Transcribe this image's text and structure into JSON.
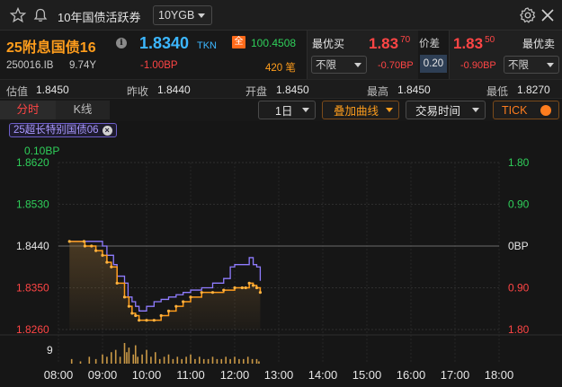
{
  "topbar": {
    "title": "10年国债活跃券",
    "selector_value": "10YGB"
  },
  "quote": {
    "name": "25附息国债16",
    "last_price": "1.8340",
    "price_source": "TKN",
    "all_badge": "全",
    "net_price": "100.4508",
    "code": "250016.IB",
    "tenor": "9.74Y",
    "change": "-1.00BP",
    "volume": "420 笔",
    "best_bid": {
      "label": "最优买",
      "price_main": "1.83",
      "price_sub": "70",
      "filter": "不限",
      "change": "-0.70BP"
    },
    "spread": {
      "label": "价差",
      "value": "0.20"
    },
    "best_ask": {
      "label": "最优卖",
      "price_main": "1.83",
      "price_sub": "50",
      "filter": "不限",
      "change": "-0.90BP"
    }
  },
  "stats": [
    {
      "label": "估值",
      "value": "1.8450"
    },
    {
      "label": "昨收",
      "value": "1.8440"
    },
    {
      "label": "开盘",
      "value": "1.8450"
    },
    {
      "label": "最高",
      "value": "1.8450"
    },
    {
      "label": "最低",
      "value": "1.8270"
    }
  ],
  "tabs": [
    {
      "label": "分时",
      "active": true
    },
    {
      "label": "K线",
      "active": false
    }
  ],
  "controls": {
    "period": "1日",
    "overlay": "叠加曲线",
    "trading_time": "交易时间",
    "tick": "TICK"
  },
  "overlay_chip": "25超长特别国债06",
  "chart_data": {
    "type": "line",
    "spread_label": "0.10BP",
    "y_left_ticks": [
      "1.8620",
      "1.8530",
      "1.8440",
      "1.8350",
      "1.8260"
    ],
    "y_right_ticks": [
      "1.80",
      "0.90",
      "0BP",
      "0.90",
      "1.80"
    ],
    "x_ticks": [
      "08:00",
      "09:00",
      "10:00",
      "11:00",
      "12:00",
      "13:00",
      "14:00",
      "15:00",
      "16:00",
      "17:00",
      "18:00"
    ],
    "volume_max_label": "9",
    "ylim": [
      1.826,
      1.862
    ],
    "prev_close": 1.844,
    "series": [
      {
        "name": "25附息国债16",
        "color": "#ff9d1c",
        "x": [
          8.25,
          8.58,
          8.6,
          8.75,
          8.85,
          9.0,
          9.1,
          9.2,
          9.33,
          9.5,
          9.6,
          9.67,
          9.75,
          9.83,
          10.0,
          10.17,
          10.33,
          10.5,
          10.67,
          10.83,
          11.0,
          11.25,
          11.5,
          11.75,
          12.0,
          12.17,
          12.25,
          12.33,
          12.42,
          12.5,
          12.58
        ],
        "y": [
          1.845,
          1.845,
          1.844,
          1.844,
          1.843,
          1.842,
          1.8405,
          1.8395,
          1.836,
          1.833,
          1.831,
          1.8295,
          1.829,
          1.828,
          1.828,
          1.828,
          1.829,
          1.83,
          1.831,
          1.832,
          1.833,
          1.834,
          1.834,
          1.8345,
          1.835,
          1.835,
          1.835,
          1.836,
          1.8355,
          1.835,
          1.834
        ]
      },
      {
        "name": "25超长特别国债06",
        "color": "#8f7cff",
        "x": [
          8.25,
          8.58,
          8.75,
          8.9,
          9.0,
          9.1,
          9.25,
          9.33,
          9.5,
          9.58,
          9.67,
          9.75,
          9.83,
          10.0,
          10.17,
          10.33,
          10.5,
          10.67,
          10.83,
          11.0,
          11.25,
          11.5,
          11.75,
          11.9,
          12.0,
          12.1,
          12.17,
          12.25,
          12.33,
          12.42,
          12.5,
          12.58
        ],
        "y": [
          1.845,
          1.845,
          1.845,
          1.845,
          1.844,
          1.842,
          1.84,
          1.8375,
          1.836,
          1.833,
          1.832,
          1.831,
          1.83,
          1.831,
          1.832,
          1.8325,
          1.833,
          1.8335,
          1.834,
          1.8345,
          1.835,
          1.836,
          1.837,
          1.8395,
          1.84,
          1.84,
          1.84,
          1.84,
          1.8415,
          1.84,
          1.8395,
          1.8365
        ]
      }
    ],
    "volume": {
      "x": [
        8.3,
        8.5,
        8.7,
        8.85,
        9.0,
        9.1,
        9.2,
        9.3,
        9.4,
        9.5,
        9.55,
        9.6,
        9.7,
        9.75,
        9.8,
        9.9,
        10.0,
        10.1,
        10.2,
        10.3,
        10.4,
        10.5,
        10.6,
        10.7,
        10.8,
        10.9,
        11.0,
        11.1,
        11.2,
        11.3,
        11.4,
        11.5,
        11.6,
        11.7,
        11.8,
        11.9,
        12.0,
        12.1,
        12.2,
        12.3,
        12.4,
        12.5,
        12.55
      ],
      "v": [
        2,
        1,
        3,
        2,
        4,
        3,
        5,
        6,
        3,
        9,
        5,
        7,
        4,
        8,
        3,
        4,
        6,
        3,
        5,
        2,
        3,
        4,
        2,
        3,
        2,
        3,
        4,
        2,
        3,
        2,
        2,
        3,
        2,
        2,
        3,
        2,
        3,
        2,
        2,
        3,
        2,
        2,
        1
      ]
    }
  }
}
